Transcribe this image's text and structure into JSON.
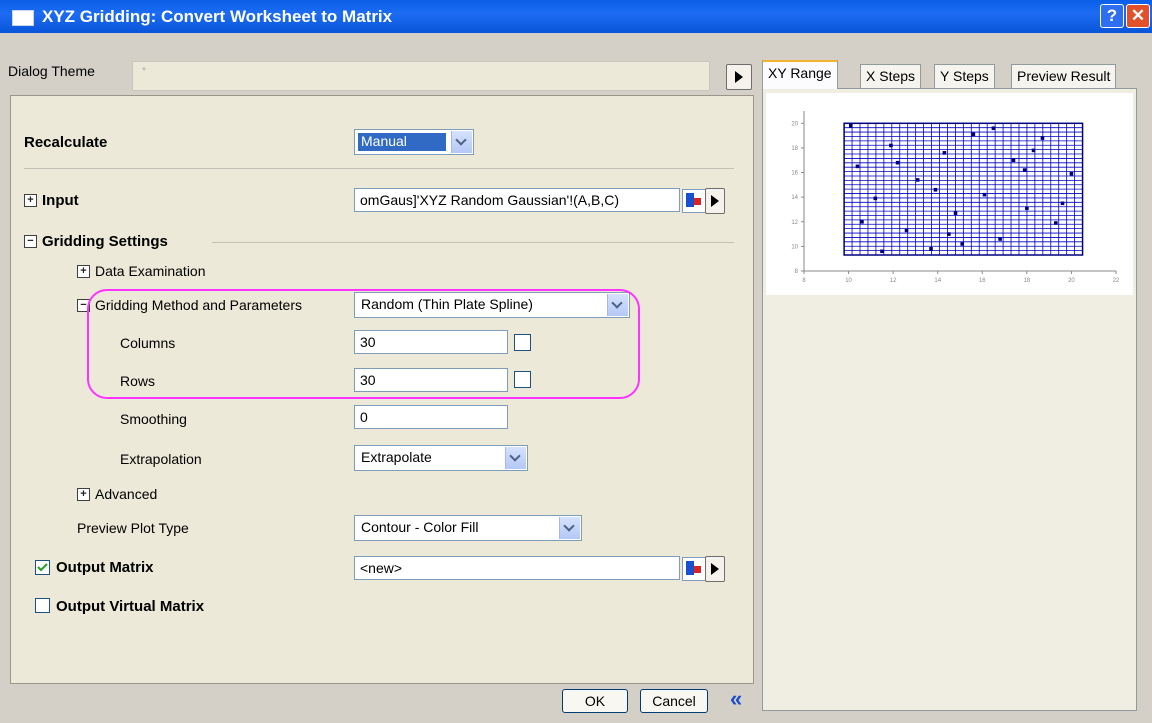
{
  "window": {
    "title": "XYZ Gridding: Convert Worksheet to Matrix",
    "help_glyph": "?",
    "close_glyph": "✕"
  },
  "theme": {
    "label": "Dialog Theme",
    "value": "*"
  },
  "form": {
    "recalculate": {
      "label": "Recalculate",
      "value": "Manual"
    },
    "input": {
      "label": "Input",
      "value": "omGaus]'XYZ Random Gaussian'!(A,B,C)"
    },
    "gridding_settings": {
      "label": "Gridding Settings"
    },
    "data_examination": {
      "label": "Data Examination"
    },
    "method": {
      "label": "Gridding Method and Parameters",
      "value": "Random (Thin Plate Spline)"
    },
    "columns": {
      "label": "Columns",
      "value": "30"
    },
    "rows": {
      "label": "Rows",
      "value": "30"
    },
    "smoothing": {
      "label": "Smoothing",
      "value": "0"
    },
    "extrapolation": {
      "label": "Extrapolation",
      "value": "Extrapolate"
    },
    "advanced": {
      "label": "Advanced"
    },
    "preview_plot_type": {
      "label": "Preview Plot Type",
      "value": "Contour - Color Fill"
    },
    "output_matrix": {
      "label": "Output Matrix",
      "value": "<new>",
      "checked": true
    },
    "output_virtual_matrix": {
      "label": "Output Virtual Matrix",
      "checked": false
    }
  },
  "tabs": [
    {
      "label": "XY Range",
      "active": true
    },
    {
      "label": "X Steps",
      "active": false
    },
    {
      "label": "Y Steps",
      "active": false
    },
    {
      "label": "Preview Result",
      "active": false
    }
  ],
  "chart_data": {
    "type": "scatter",
    "x_ticks": [
      "8",
      "10",
      "12",
      "14",
      "16",
      "18",
      "20",
      "22"
    ],
    "y_ticks": [
      "8",
      "10",
      "12",
      "14",
      "16",
      "18",
      "20"
    ],
    "xlim": [
      8,
      22
    ],
    "ylim": [
      8,
      21
    ],
    "grid_columns": 30,
    "grid_rows": 30,
    "grid_x_range": [
      9.8,
      20.5
    ],
    "grid_y_range": [
      9.3,
      20.0
    ],
    "points_x": [
      10.1,
      10.4,
      11.2,
      11.9,
      12.6,
      13.1,
      13.7,
      14.3,
      14.8,
      15.6,
      16.1,
      16.8,
      17.4,
      18.0,
      18.7,
      19.3,
      20.0,
      10.6,
      12.2,
      13.9,
      15.1,
      16.5,
      17.9,
      19.6,
      11.5,
      14.5,
      18.3
    ],
    "points_y": [
      19.8,
      16.5,
      13.9,
      18.2,
      11.3,
      15.4,
      9.8,
      17.6,
      12.7,
      19.1,
      14.2,
      10.6,
      17.0,
      13.1,
      18.8,
      11.9,
      15.9,
      12.0,
      16.8,
      14.6,
      10.2,
      19.6,
      16.2,
      13.5,
      9.6,
      11.0,
      17.8
    ],
    "grid": true,
    "marker_color": "#000080",
    "grid_color": "#0000c0"
  },
  "buttons": {
    "ok": "OK",
    "cancel": "Cancel",
    "collapse": "«"
  },
  "colors": {
    "titlebar": "#0a5ee8",
    "highlight": "#ff33ff",
    "accent_tab": "#f0b430"
  }
}
